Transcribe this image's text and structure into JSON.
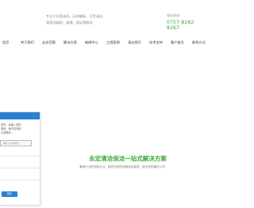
{
  "header": {
    "intro_line1": "专注于外墙清洗、石材翻新、开荒清洁、",
    "intro_line2": "清理油烟机、疏通、保洁等服务",
    "hotline_label": "服务热线",
    "hotline_number": "0757-8282 8267"
  },
  "nav": {
    "items": [
      {
        "label": "首页"
      },
      {
        "label": "关于我们"
      },
      {
        "label": "业务范围"
      },
      {
        "label": "解决方案"
      },
      {
        "label": "新闻中心"
      },
      {
        "label": "工程案例"
      },
      {
        "label": "清洁常识"
      },
      {
        "label": "技术支持"
      },
      {
        "label": "客户留言"
      },
      {
        "label": "联系方式"
      }
    ]
  },
  "contact_box": {
    "text": "您好，请输入您的需求，我们将尽快与您联系...",
    "input_placeholder": "请输入您的电话",
    "button_label": "提交"
  },
  "hero": {
    "title": "永宏清洁保洁一站式解决方案",
    "subtitle": "秉承行业的领军企业，国内先进的设备及其高质、精业务的操作人员"
  },
  "colors": {
    "accent_green": "#3aa935",
    "accent_blue": "#2d7fd0"
  }
}
